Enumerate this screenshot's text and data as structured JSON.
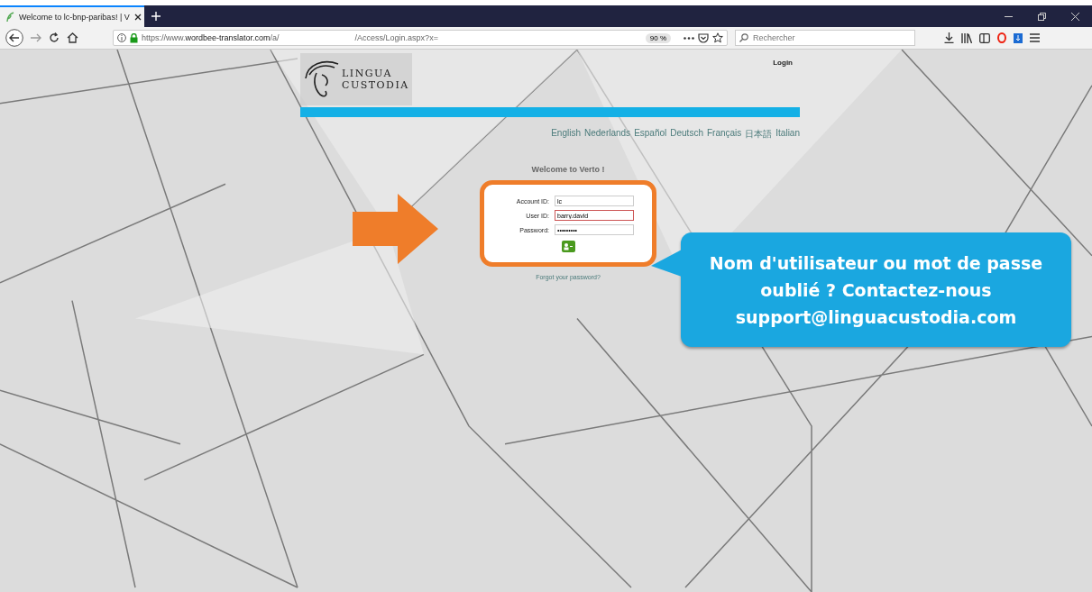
{
  "browser": {
    "tab": {
      "title": "Welcome to lc-bnp-paribas! | V",
      "selected": true
    },
    "url": {
      "prefix": "https://www.",
      "domain": "wordbee-translator.com",
      "path": "/a/",
      "rest": "/Access/Login.aspx?x="
    },
    "zoom": "90 %",
    "search": {
      "placeholder": "Rechercher"
    }
  },
  "header": {
    "logo_line1": "LINGUA",
    "logo_line2": "CUSTODIA",
    "login_link": "Login"
  },
  "languages": [
    {
      "label": "English"
    },
    {
      "label": "Nederlands"
    },
    {
      "label": "Español"
    },
    {
      "label": "Deutsch"
    },
    {
      "label": "Français"
    },
    {
      "label": "日本語"
    },
    {
      "label": "Italian"
    }
  ],
  "welcome": "Welcome to Verto !",
  "form": {
    "fields": [
      {
        "label": "Account ID:",
        "value": "lc",
        "focused": false
      },
      {
        "label": "User ID:",
        "value": "barry.david",
        "focused": true
      },
      {
        "label": "Password:",
        "value": "•••••••••",
        "focused": false
      }
    ],
    "forgot": "Forgot your password?"
  },
  "callout": {
    "lines": [
      "Nom d'utilisateur ou mot de passe",
      "oublié ? Contactez-nous",
      "support@linguacustodia.com"
    ]
  }
}
